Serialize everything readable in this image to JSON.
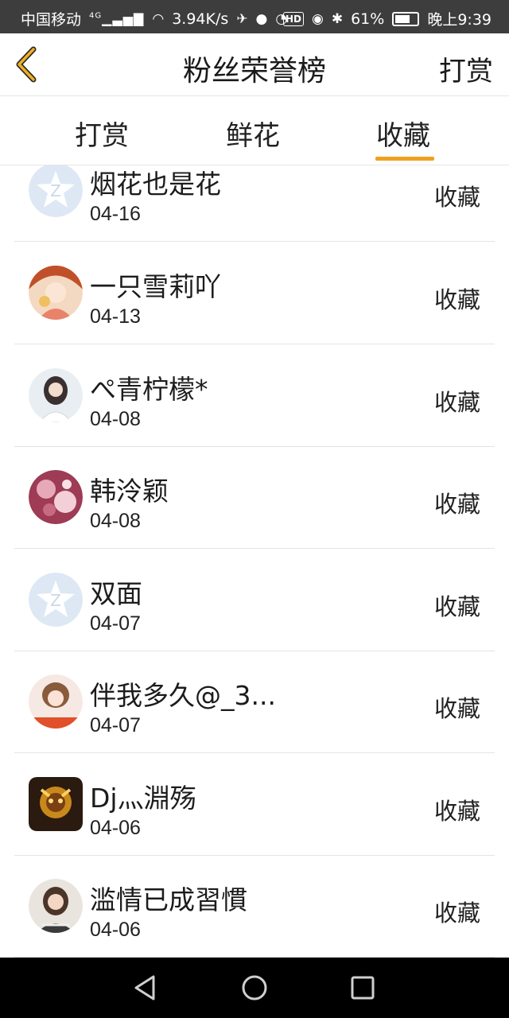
{
  "status": {
    "carrier": "中国移动",
    "network": "4G",
    "speed": "3.94K/s",
    "battery": "61%",
    "time": "晚上9:39"
  },
  "header": {
    "title": "粉丝荣誉榜",
    "right_label": "打赏"
  },
  "tabs": {
    "t1": "打赏",
    "t2": "鲜花",
    "t3": "收藏",
    "active": "收藏",
    "active_color": "#f0a020"
  },
  "fans": [
    {
      "name": "烟花也是花",
      "date": "04-16",
      "action": "收藏",
      "avatar": "default-qq-avatar"
    },
    {
      "name": "一只雪莉吖",
      "date": "04-13",
      "action": "收藏",
      "avatar": "anime-girl-avatar"
    },
    {
      "name": "ぺ青柠檬*",
      "date": "04-08",
      "action": "收藏",
      "avatar": "girl-photo-avatar"
    },
    {
      "name": "韩泠颖",
      "date": "04-08",
      "action": "收藏",
      "avatar": "flower-avatar"
    },
    {
      "name": "双面",
      "date": "04-07",
      "action": "收藏",
      "avatar": "default-qq-avatar"
    },
    {
      "name": "伴我多久@_3...",
      "date": "04-07",
      "action": "收藏",
      "avatar": "girl-photo-avatar"
    },
    {
      "name": "Dj灬淵殇",
      "date": "04-06",
      "action": "收藏",
      "avatar": "warrior-avatar"
    },
    {
      "name": "滥情已成習慣",
      "date": "04-06",
      "action": "收藏",
      "avatar": "girl-photo-avatar"
    }
  ]
}
